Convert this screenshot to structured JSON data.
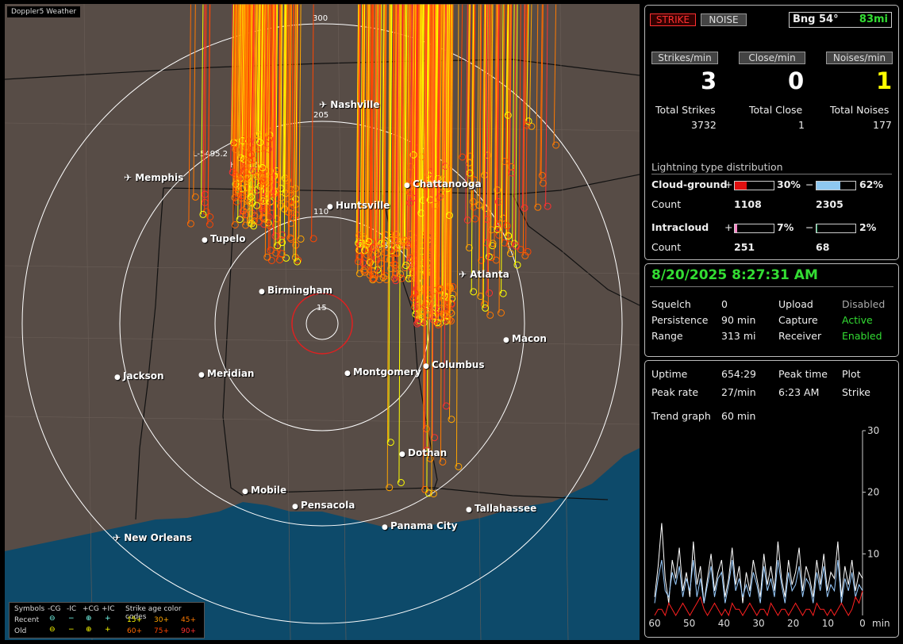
{
  "map": {
    "app_title": "Doppler5 Weather",
    "ring_labels": [
      "300",
      "205",
      "110",
      "15"
    ],
    "tracks": [
      "L-5495.2",
      "H-3506.1",
      "L-5733.2"
    ],
    "cities": [
      {
        "name": "Nashville",
        "type": "airport"
      },
      {
        "name": "Memphis",
        "type": "airport"
      },
      {
        "name": "Chattanooga",
        "type": "city"
      },
      {
        "name": "Huntsville",
        "type": "city"
      },
      {
        "name": "Tupelo",
        "type": "city"
      },
      {
        "name": "Atlanta",
        "type": "airport"
      },
      {
        "name": "Birmingham",
        "type": "city"
      },
      {
        "name": "Macon",
        "type": "city"
      },
      {
        "name": "Jackson",
        "type": "city"
      },
      {
        "name": "Meridian",
        "type": "city"
      },
      {
        "name": "Montgomery",
        "type": "city"
      },
      {
        "name": "Columbus",
        "type": "city"
      },
      {
        "name": "Dothan",
        "type": "city"
      },
      {
        "name": "Mobile",
        "type": "city"
      },
      {
        "name": "Pensacola",
        "type": "city"
      },
      {
        "name": "Tallahassee",
        "type": "city"
      },
      {
        "name": "Panama City",
        "type": "city"
      },
      {
        "name": "New Orleans",
        "type": "airport"
      }
    ]
  },
  "legend": {
    "symbols_label": "Symbols",
    "cols": [
      "-CG",
      "-IC",
      "+CG",
      "+IC"
    ],
    "recent_label": "Recent",
    "old_label": "Old",
    "age_title": "Strike age color codes",
    "recent_ages": [
      "15+",
      "30+",
      "45+"
    ],
    "old_ages": [
      "60+",
      "75+",
      "90+"
    ],
    "age_colors": [
      "#ffff00",
      "#ffa500",
      "#ff7a00",
      "#ff6a00",
      "#ff4500",
      "#ff3030"
    ]
  },
  "top": {
    "strike_btn": "STRIKE",
    "noise_btn": "NOISE",
    "bearing": "Bng 54°",
    "distance": "83mi",
    "strikes_min_label": "Strikes/min",
    "close_min_label": "Close/min",
    "noises_min_label": "Noises/min",
    "strikes_min": "3",
    "close_min": "0",
    "noises_min": "1",
    "total_strikes_label": "Total Strikes",
    "total_close_label": "Total Close",
    "total_noises_label": "Total Noises",
    "total_strikes": "3732",
    "total_close": "1",
    "total_noises": "177",
    "dist_title": "Lightning type distribution",
    "cloud_ground_label": "Cloud-ground",
    "intracloud_label": "Intracloud",
    "count_label": "Count",
    "cg_pos_pct": "30%",
    "cg_neg_pct": "62%",
    "cg_pos_count": "1108",
    "cg_neg_count": "2305",
    "ic_pos_pct": "7%",
    "ic_neg_pct": "2%",
    "ic_pos_count": "251",
    "ic_neg_count": "68",
    "cg_pos_frac": 0.3,
    "cg_neg_frac": 0.62,
    "ic_pos_frac": 0.07,
    "ic_neg_frac": 0.02,
    "plus": "+",
    "minus": "−"
  },
  "status": {
    "datetime": "8/20/2025 8:27:31 AM",
    "squelch_label": "Squelch",
    "squelch": "0",
    "persistence_label": "Persistence",
    "persistence": "90 min",
    "range_label": "Range",
    "range": "313 mi",
    "upload_label": "Upload",
    "upload": "Disabled",
    "capture_label": "Capture",
    "capture": "Active",
    "receiver_label": "Receiver",
    "receiver": "Enabled",
    "colors": {
      "disabled": "#aaaaaa",
      "active": "#33dd33"
    }
  },
  "stats": {
    "uptime_label": "Uptime",
    "uptime": "654:29",
    "peak_time_label": "Peak time",
    "peak_time": "6:23 AM",
    "plot_label": "Plot",
    "plot": "Strike",
    "peak_rate_label": "Peak rate",
    "peak_rate": "27/min",
    "trend_label": "Trend graph",
    "trend": "60 min"
  },
  "chart_data": {
    "type": "line",
    "x_ticks": [
      "60",
      "50",
      "40",
      "30",
      "20",
      "10",
      "0"
    ],
    "x_unit": "min",
    "y_ticks": [
      "30",
      "20",
      "10"
    ],
    "ylim": [
      0,
      30
    ],
    "series_colors": [
      "#ffffff",
      "#99ccff",
      "#ff2020"
    ],
    "series": [
      {
        "values": [
          3,
          8,
          15,
          6,
          2,
          9,
          6,
          11,
          4,
          7,
          3,
          12,
          5,
          8,
          2,
          6,
          10,
          4,
          7,
          9,
          3,
          6,
          11,
          5,
          8,
          2,
          7,
          4,
          9,
          6,
          3,
          10,
          5,
          8,
          4,
          12,
          6,
          3,
          9,
          5,
          7,
          11,
          4,
          8,
          6,
          3,
          9,
          5,
          10,
          4,
          7,
          6,
          12,
          3,
          8,
          5,
          9,
          4,
          7,
          6
        ]
      },
      {
        "values": [
          2,
          6,
          9,
          4,
          3,
          7,
          5,
          8,
          3,
          6,
          4,
          9,
          3,
          6,
          2,
          5,
          8,
          3,
          6,
          7,
          2,
          5,
          9,
          4,
          6,
          3,
          5,
          3,
          7,
          5,
          2,
          8,
          4,
          6,
          3,
          9,
          5,
          2,
          7,
          4,
          5,
          8,
          3,
          6,
          5,
          2,
          7,
          4,
          8,
          3,
          5,
          4,
          9,
          2,
          6,
          4,
          7,
          3,
          5,
          4
        ]
      },
      {
        "values": [
          0,
          1,
          1,
          0,
          2,
          1,
          0,
          1,
          2,
          1,
          0,
          1,
          2,
          3,
          1,
          0,
          1,
          2,
          1,
          0,
          1,
          0,
          2,
          1,
          1,
          0,
          1,
          2,
          1,
          0,
          1,
          1,
          0,
          2,
          1,
          0,
          1,
          1,
          0,
          1,
          2,
          1,
          0,
          1,
          1,
          0,
          2,
          1,
          1,
          0,
          1,
          0,
          1,
          2,
          1,
          0,
          1,
          3,
          2,
          4
        ]
      }
    ]
  }
}
